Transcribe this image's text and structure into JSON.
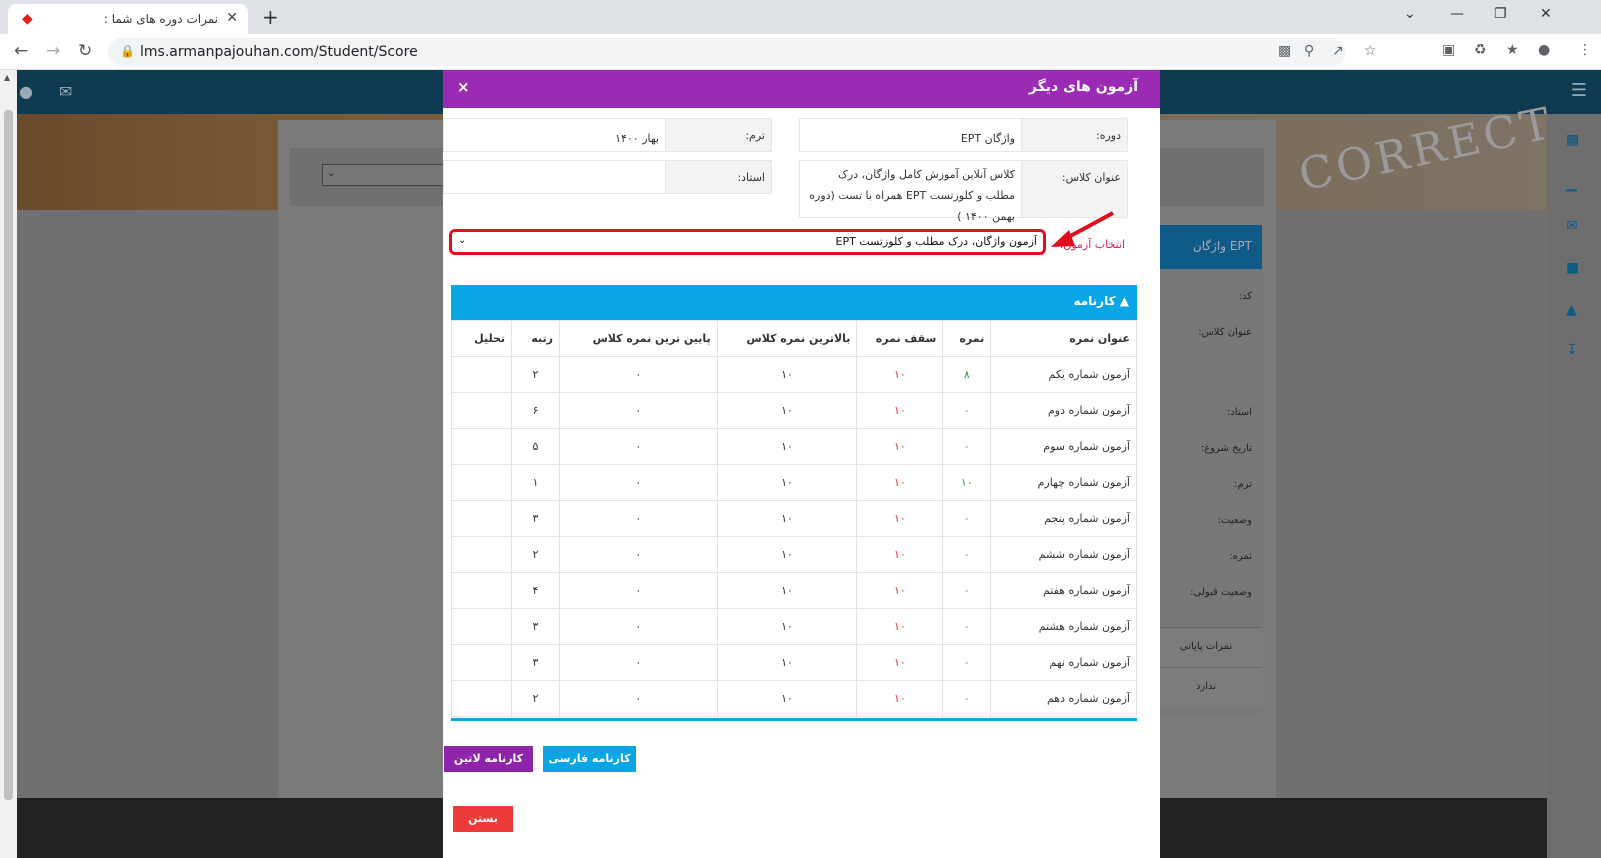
{
  "browser": {
    "tab_title": "نمرات دوره های شما :",
    "url": "lms.armanpajouhan.com/Student/Score"
  },
  "background": {
    "stamp_text": "CORRECT"
  },
  "modal": {
    "title": "آزمون های دیگر",
    "close_glyph": "×",
    "course_label": "دوره:",
    "course_value": "واژگان EPT",
    "term_label": "ترم:",
    "term_value": "بهار ۱۴۰۰",
    "class_title_label": "عنوان کلاس:",
    "class_title_value": "کلاس آنلاین آموزش کامل واژگان، درک مطلب و کلوزتست EPT همراه با تست (دوره بهمن ۱۴۰۰ )",
    "teacher_label": "استاد:",
    "teacher_value": "",
    "exam_select_label": "انتخاب آزمون:",
    "exam_select_value": "آزمون واژگان، درک مطلب و کلوزتست EPT",
    "report_card": {
      "title": "کارنامه",
      "columns": [
        "عنوان نمره",
        "نمره",
        "سقف نمره",
        "بالاترین نمره کلاس",
        "پایین ترین نمره کلاس",
        "رتبه",
        "تحلیل"
      ],
      "rows": [
        {
          "name": "آزمون شماره یکم",
          "score": "۸",
          "max": "۱۰",
          "highest": "۱۰",
          "lowest": "۰",
          "rank": "۲",
          "analysis": ""
        },
        {
          "name": "آزمون شماره دوم",
          "score": "۰",
          "max": "۱۰",
          "highest": "۱۰",
          "lowest": "۰",
          "rank": "۶",
          "analysis": ""
        },
        {
          "name": "آزمون شماره سوم",
          "score": "۰",
          "max": "۱۰",
          "highest": "۱۰",
          "lowest": "۰",
          "rank": "۵",
          "analysis": ""
        },
        {
          "name": "آزمون شماره چهارم",
          "score": "۱۰",
          "max": "۱۰",
          "highest": "۱۰",
          "lowest": "۰",
          "rank": "۱",
          "analysis": ""
        },
        {
          "name": "آزمون شماره پنجم",
          "score": "۰",
          "max": "۱۰",
          "highest": "۱۰",
          "lowest": "۰",
          "rank": "۳",
          "analysis": ""
        },
        {
          "name": "آزمون شماره ششم",
          "score": "۰",
          "max": "۱۰",
          "highest": "۱۰",
          "lowest": "۰",
          "rank": "۲",
          "analysis": ""
        },
        {
          "name": "آزمون شماره هفتم",
          "score": "۰",
          "max": "۱۰",
          "highest": "۱۰",
          "lowest": "۰",
          "rank": "۴",
          "analysis": ""
        },
        {
          "name": "آزمون شماره هشتم",
          "score": "۰",
          "max": "۱۰",
          "highest": "۱۰",
          "lowest": "۰",
          "rank": "۳",
          "analysis": ""
        },
        {
          "name": "آزمون شماره نهم",
          "score": "۰",
          "max": "۱۰",
          "highest": "۱۰",
          "lowest": "۰",
          "rank": "۳",
          "analysis": ""
        },
        {
          "name": "آزمون شماره دهم",
          "score": "۰",
          "max": "۱۰",
          "highest": "۱۰",
          "lowest": "۰",
          "rank": "۲",
          "analysis": ""
        }
      ]
    },
    "btn_farsi_report": "کارنامه فارسی",
    "btn_latin_report": "کارنامه لاتین",
    "btn_close": "بستن"
  },
  "background_sidebar": {
    "course_title": "واژگان EPT",
    "labels": [
      "کد:",
      "عنوان کلاس:",
      "استاد:",
      "تاریخ شروع:",
      "ترم:",
      "وضعیت:",
      "نمره:",
      "وضعیت قبولی:"
    ],
    "final_scores_button": "نمرات پایانی",
    "none_text": "ندارد"
  },
  "colors": {
    "modal_header": "#9b2ab5",
    "panel_header": "#0aa5e5",
    "highlight_red": "#e10d1c",
    "score_green": "#2e9e46",
    "max_red": "#d9333f"
  },
  "icons": [
    "gem-favicon",
    "close-tab-icon",
    "new-tab-icon",
    "back-icon",
    "forward-icon",
    "reload-icon",
    "lock-icon",
    "translate-icon",
    "zoom-icon",
    "share-icon",
    "star-icon",
    "extensions-icon",
    "profile-icon",
    "kebab-menu-icon",
    "graduation-cap-icon",
    "red-arrow-annotation"
  ]
}
